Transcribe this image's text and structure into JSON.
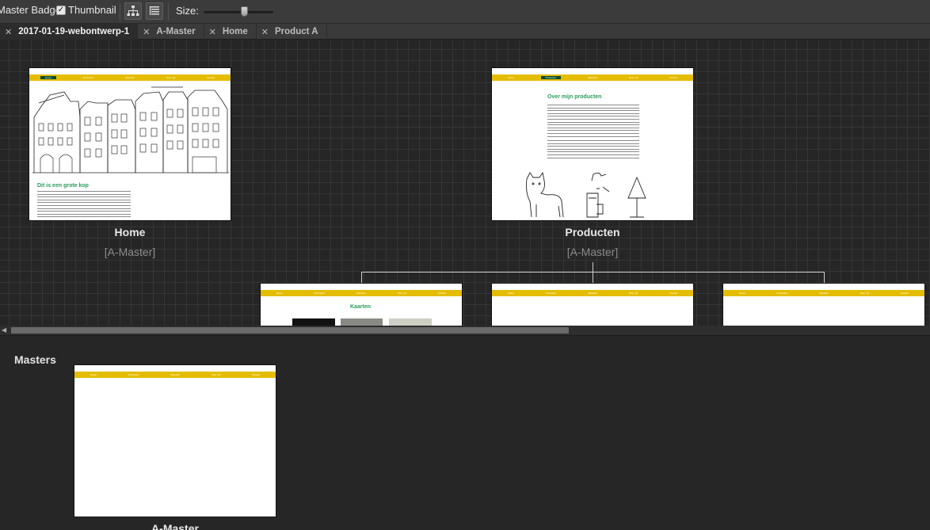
{
  "toolbar": {
    "master_badge_label": "Master Badge",
    "thumbnail_label": "Thumbnail",
    "thumbnail_checked": "✓",
    "size_label": "Size:",
    "size_value": 0.6
  },
  "tabs": [
    {
      "label": "2017-01-19-webontwerp-1",
      "active": true
    },
    {
      "label": "A-Master"
    },
    {
      "label": "Home"
    },
    {
      "label": "Product A"
    }
  ],
  "nav_items": [
    "Home",
    "Producten",
    "Sieraden",
    "Over mij",
    "Contact"
  ],
  "pages": {
    "home": {
      "name": "Home",
      "master": "[A-Master]",
      "heading": "Dit is een grote kop"
    },
    "producten": {
      "name": "Producten",
      "master": "[A-Master]",
      "heading": "Over mijn producten"
    },
    "kaarten": {
      "heading": "Kaarten"
    }
  },
  "masters_panel": {
    "title": "Masters",
    "a_master_name": "A-Master"
  }
}
